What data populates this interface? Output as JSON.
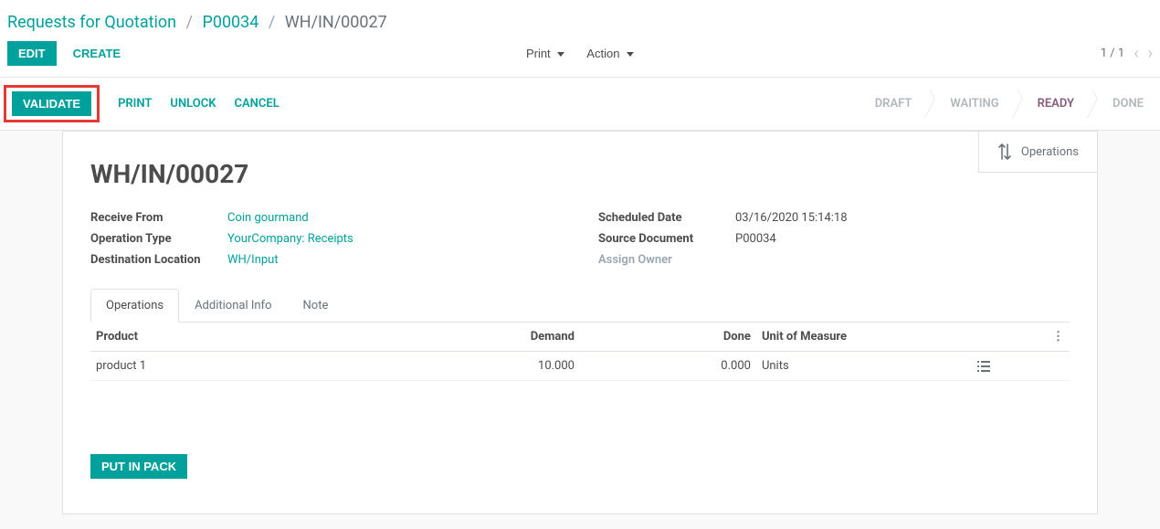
{
  "breadcrumb": {
    "root": "Requests for Quotation",
    "parent": "P00034",
    "current": "WH/IN/00027"
  },
  "control": {
    "edit": "EDIT",
    "create": "CREATE",
    "print": "Print",
    "action": "Action",
    "pager": "1 / 1"
  },
  "actions": {
    "validate": "VALIDATE",
    "print": "PRINT",
    "unlock": "UNLOCK",
    "cancel": "CANCEL"
  },
  "status": {
    "draft": "DRAFT",
    "waiting": "WAITING",
    "ready": "READY",
    "done": "DONE",
    "active": "ready"
  },
  "stat": {
    "label": "Operations"
  },
  "record": {
    "title": "WH/IN/00027",
    "left": {
      "receive_from_label": "Receive From",
      "receive_from_value": "Coin gourmand",
      "operation_type_label": "Operation Type",
      "operation_type_value": "YourCompany: Receipts",
      "destination_location_label": "Destination Location",
      "destination_location_value": "WH/Input"
    },
    "right": {
      "scheduled_date_label": "Scheduled Date",
      "scheduled_date_value": "03/16/2020 15:14:18",
      "source_document_label": "Source Document",
      "source_document_value": "P00034",
      "assign_owner_label": "Assign Owner"
    }
  },
  "tabs": {
    "operations": "Operations",
    "additional_info": "Additional Info",
    "note": "Note"
  },
  "table": {
    "headers": {
      "product": "Product",
      "demand": "Demand",
      "done": "Done",
      "uom": "Unit of Measure"
    },
    "rows": [
      {
        "product": "product 1",
        "demand": "10.000",
        "done": "0.000",
        "uom": "Units"
      }
    ]
  },
  "put_in_pack": "PUT IN PACK"
}
